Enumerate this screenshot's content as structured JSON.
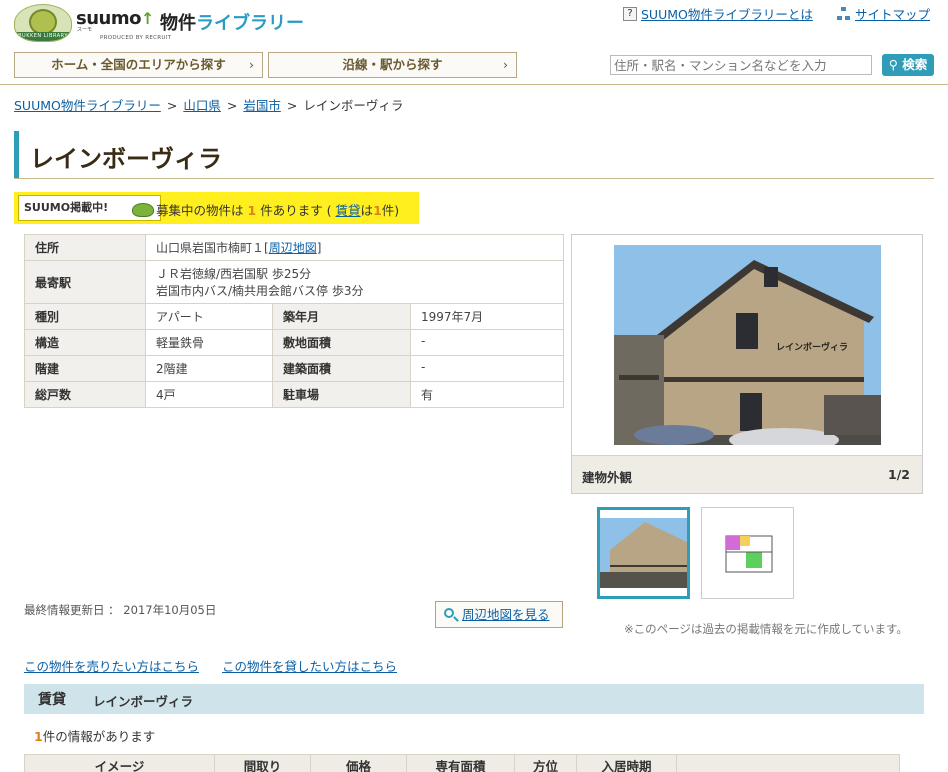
{
  "header": {
    "logo_badge": "BUKKEN LIBRARY",
    "brand": "suumo",
    "brand_kana": "スーモ",
    "produced_by": "PRODUCED BY RECRUIT",
    "brand_jp_1": "物件",
    "brand_jp_2": "ライブラリー",
    "about_link": "SUUMO物件ライブラリーとは",
    "sitemap_link": "サイトマップ",
    "nav_area": "ホーム・全国のエリアから探す",
    "nav_line": "沿線・駅から探す",
    "search_placeholder": "住所・駅名・マンション名などを入力",
    "search_button": "検索"
  },
  "breadcrumb": {
    "items": [
      "SUUMO物件ライブラリー",
      "山口県",
      "岩国市"
    ],
    "separator": ">",
    "current": "レインボーヴィラ"
  },
  "page_title": "レインボーヴィラ",
  "notice": {
    "tag": "SUUMO掲載中!",
    "pre": "募集中の物件は",
    "count": "1",
    "mid": "件あります (",
    "rent_label": "賃貸",
    "rent_pre": "は",
    "rent_count": "1",
    "rent_post": "件)"
  },
  "info": {
    "address_label": "住所",
    "address_value": "山口県岩国市楠町１",
    "address_map_open": "[",
    "address_map_link": "周辺地図",
    "address_map_close": "]",
    "station_label": "最寄駅",
    "station_line1": "ＪＲ岩徳線/西岩国駅 歩25分",
    "station_line2": "岩国市内バス/楠共用会館バス停 歩3分",
    "type_label": "種別",
    "type_value": "アパート",
    "built_label": "築年月",
    "built_value": "1997年7月",
    "structure_label": "構造",
    "structure_value": "軽量鉄骨",
    "land_label": "敷地面積",
    "land_value": "-",
    "floors_label": "階建",
    "floors_value": "2階建",
    "building_area_label": "建築面積",
    "building_area_value": "-",
    "units_label": "総戸数",
    "units_value": "4戸",
    "parking_label": "駐車場",
    "parking_value": "有"
  },
  "photo": {
    "sign_text": "レインボーヴィラ",
    "caption": "建物外観",
    "counter": "1/2"
  },
  "footer_info": {
    "updated": "最終情報更新日 ： 2017年10月05日",
    "map_button": "周辺地図を見る",
    "past_note": "※このページは過去の掲載情報を元に作成しています。",
    "sell_link": "この物件を売りたい方はこちら",
    "rent_link": "この物件を貸したい方はこちら"
  },
  "rent_section": {
    "heading": "賃貸",
    "name": "レインボーヴィラ",
    "count": "1",
    "count_text": "件の情報があります",
    "columns": [
      "イメージ",
      "間取り",
      "価格",
      "専有面積",
      "方位",
      "入居時期"
    ]
  },
  "colors": {
    "accent": "#2f9db8",
    "notice_bg": "#ffef1e",
    "highlight_num": "#e0811b",
    "link": "#0b5fa5"
  }
}
